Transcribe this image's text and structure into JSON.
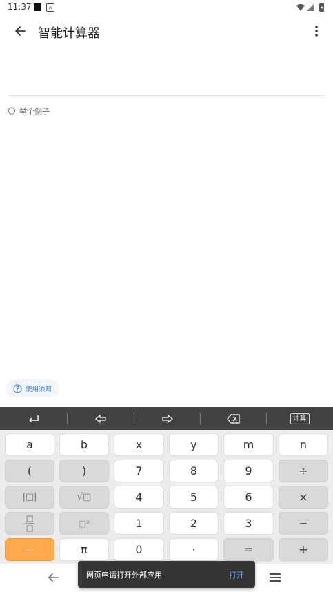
{
  "status_bar": {
    "time": "11:37",
    "a_label": "A"
  },
  "app_bar": {
    "title": "智能计算器"
  },
  "example": {
    "label": "举个例子"
  },
  "notice": {
    "label": "使用须知"
  },
  "toolbar": {
    "calc_label": "计算"
  },
  "keyboard": {
    "rows": [
      [
        "a",
        "b",
        "x",
        "y",
        "m",
        "n"
      ],
      [
        "(",
        ")",
        "7",
        "8",
        "9",
        "÷"
      ],
      [
        "|□|",
        "√□",
        "4",
        "5",
        "6",
        "×"
      ],
      [
        "fraction",
        "□²",
        "1",
        "2",
        "3",
        "−"
      ],
      [
        "···",
        "π",
        "0",
        "·",
        "=",
        "+"
      ]
    ]
  },
  "toast": {
    "message": "网页申请打开外部应用",
    "action": "打开"
  },
  "colors": {
    "accent": "#ffa94d",
    "toolbar": "#424242",
    "link": "#3a7bd5"
  }
}
